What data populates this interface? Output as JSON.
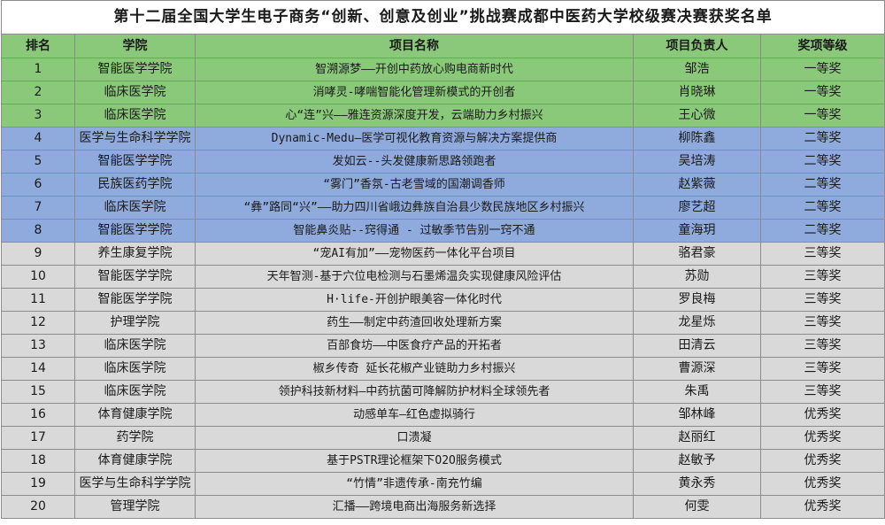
{
  "title": "第十二届全国大学生电子商务“创新、创意及创业”挑战赛成都中医药大学校级赛决赛获奖名单",
  "headers": {
    "rank": "排名",
    "college": "学院",
    "project": "项目名称",
    "leader": "项目负责人",
    "award": "奖项等级"
  },
  "rows": [
    {
      "rank": "1",
      "college": "智能医学学院",
      "project": "智溯源梦——开创中药放心购电商新时代",
      "leader": "邹浩",
      "award": "一等奖"
    },
    {
      "rank": "2",
      "college": "临床医学院",
      "project": "消哮灵-哮喘智能化管理新模式的开创者",
      "leader": "肖晓琳",
      "award": "一等奖"
    },
    {
      "rank": "3",
      "college": "临床医学院",
      "project": "心“连”兴——雅连资源深度开发，云端助力乡村振兴",
      "leader": "王心微",
      "award": "一等奖"
    },
    {
      "rank": "4",
      "college": "医学与生命科学学院",
      "project": "Dynamic-Medu—医学可视化教育资源与解决方案提供商",
      "leader": "柳陈鑫",
      "award": "二等奖"
    },
    {
      "rank": "5",
      "college": "智能医学学院",
      "project": "发如云--头发健康新思路领跑者",
      "leader": "吴培涛",
      "award": "二等奖"
    },
    {
      "rank": "6",
      "college": "民族医药学院",
      "project": "“雾门”香氛-古老雪域的国潮调香师",
      "leader": "赵紫薇",
      "award": "二等奖"
    },
    {
      "rank": "7",
      "college": "临床医学院",
      "project": "“彝”路同“兴”——助力四川省峨边彝族自治县少数民族地区乡村振兴",
      "leader": "廖艺超",
      "award": "二等奖"
    },
    {
      "rank": "8",
      "college": "智能医学学院",
      "project": "智能鼻炎贴--窍得通 - 过敏季节告别一窍不通",
      "leader": "童海玥",
      "award": "二等奖"
    },
    {
      "rank": "9",
      "college": "养生康复学院",
      "project": "“宠AI有加”——宠物医药一体化平台项目",
      "leader": "骆君豪",
      "award": "三等奖"
    },
    {
      "rank": "10",
      "college": "智能医学学院",
      "project": "天年智测-基于穴位电检测与石墨烯温灸实现健康风险评估",
      "leader": "苏勋",
      "award": "三等奖"
    },
    {
      "rank": "11",
      "college": "智能医学学院",
      "project": "H·life-开创护眼美容一体化时代",
      "leader": "罗良梅",
      "award": "三等奖"
    },
    {
      "rank": "12",
      "college": "护理学院",
      "project": "药生——制定中药渣回收处理新方案",
      "leader": "龙星烁",
      "award": "三等奖"
    },
    {
      "rank": "13",
      "college": "临床医学院",
      "project": "百部食坊——中医食疗产品的开拓者",
      "leader": "田清云",
      "award": "三等奖"
    },
    {
      "rank": "14",
      "college": "临床医学院",
      "project": "椒乡传奇 延长花椒产业链助力乡村振兴",
      "leader": "曹源深",
      "award": "三等奖"
    },
    {
      "rank": "15",
      "college": "临床医学院",
      "project": "领护科技新材料—中药抗菌可降解防护材料全球领先者",
      "leader": "朱禹",
      "award": "三等奖"
    },
    {
      "rank": "16",
      "college": "体育健康学院",
      "project": "动感单车—红色虚拟骑行",
      "leader": "邹林峰",
      "award": "优秀奖"
    },
    {
      "rank": "17",
      "college": "药学院",
      "project": "口溃凝",
      "leader": "赵丽红",
      "award": "优秀奖"
    },
    {
      "rank": "18",
      "college": "体育健康学院",
      "project": "基于PSTR理论框架下O2O服务模式",
      "leader": "赵敏予",
      "award": "优秀奖"
    },
    {
      "rank": "19",
      "college": "医学与生命科学学院",
      "project": "“竹情”非遗传承-南充竹编",
      "leader": "黄永秀",
      "award": "优秀奖"
    },
    {
      "rank": "20",
      "college": "管理学院",
      "project": "汇播——跨境电商出海服务新选择",
      "leader": "何雯",
      "award": "优秀奖"
    }
  ],
  "colors": {
    "first_prize": "#8bc97a",
    "second_prize": "#8faadc",
    "third_and_merit": "#d9d9d9"
  }
}
